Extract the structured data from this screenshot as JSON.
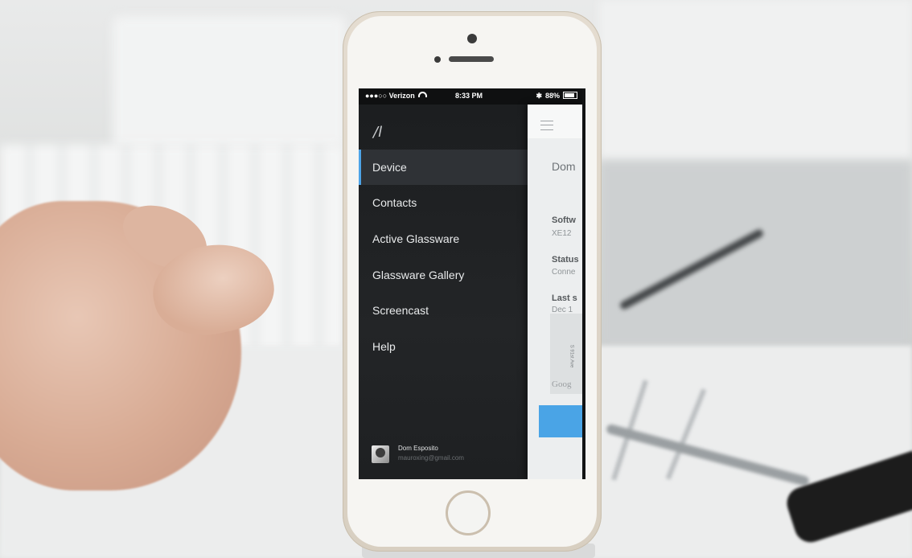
{
  "status_bar": {
    "carrier": "●●●○○ Verizon",
    "time": "8:33 PM",
    "bluetooth": "✱",
    "battery": "88%"
  },
  "app": {
    "logo_glyph": "/l"
  },
  "menu": {
    "items": [
      {
        "label": "Device",
        "active": true
      },
      {
        "label": "Contacts"
      },
      {
        "label": "Active Glassware"
      },
      {
        "label": "Glassware Gallery"
      },
      {
        "label": "Screencast"
      },
      {
        "label": "Help"
      }
    ],
    "user": {
      "name": "Dom Esposito",
      "email": "mauroxing@gmail.com"
    }
  },
  "content": {
    "device_name": "Dom",
    "software_label": "Softw",
    "software_value": "XE12",
    "status_label": "Status",
    "status_value": "Conne",
    "last_label": "Last s",
    "last_value": "Dec 1",
    "map_street": "S 91st Ave",
    "map_brand": "Goog"
  },
  "colors": {
    "accent": "#4ea4e8",
    "menu_bg": "#1f2123",
    "phone_body": "#e4dcd0"
  }
}
